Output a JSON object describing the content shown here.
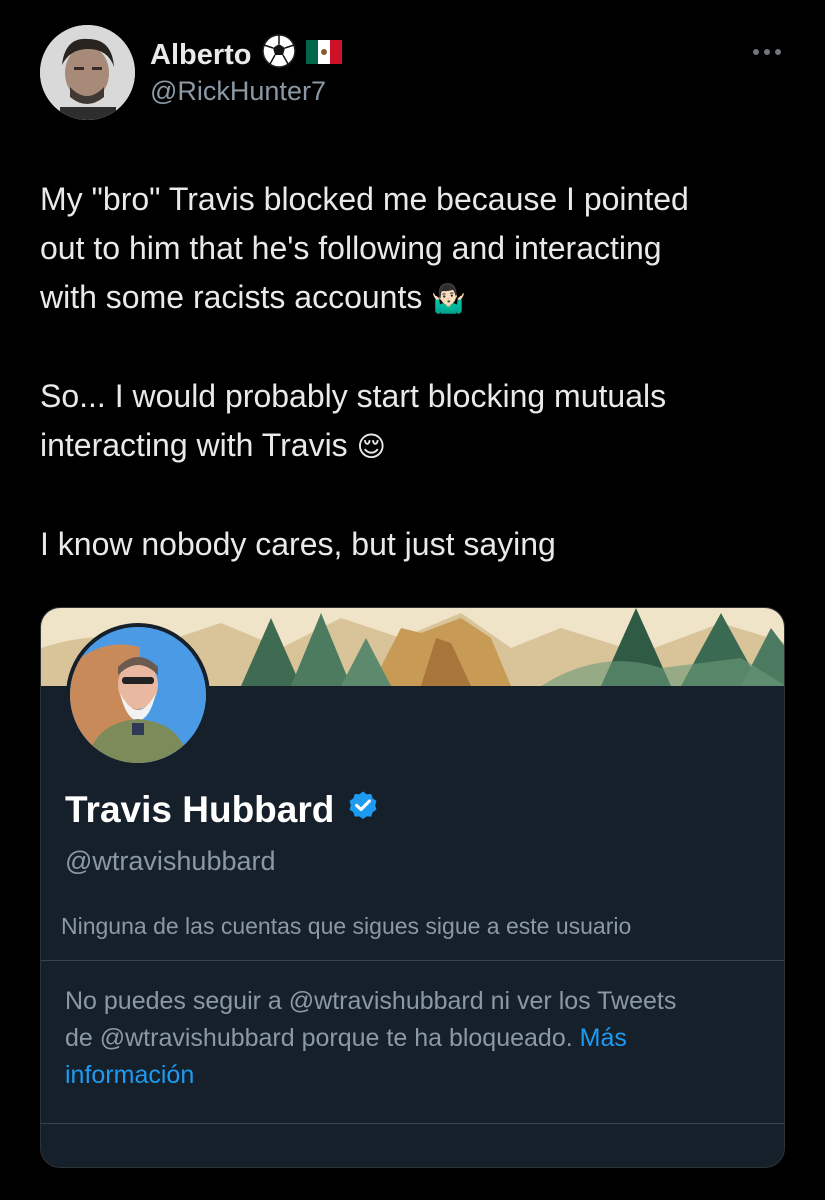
{
  "tweet": {
    "author": {
      "name": "Alberto",
      "handle": "@RickHunter7",
      "badges": [
        "soccer-ball-icon",
        "mexico-flag-icon"
      ]
    },
    "more_icon": "more-options-icon",
    "text_lines": [
      "My \"bro\" Travis blocked me because I pointed",
      "out to him that he's following and interacting",
      "with some racists accounts",
      "So... I would probably start blocking mutuals",
      "interacting with Travis",
      "I know nobody cares, but just saying"
    ],
    "emoji_shrug": "🤷🏻‍♂️",
    "emoji_relieved": "😌"
  },
  "profile_card": {
    "name": "Travis Hubbard",
    "verified_icon": "verified-badge-icon",
    "handle": "@wtravishubbard",
    "follow_note": "Ninguna de las cuentas que sigues sigue a este usuario",
    "blocked_text_1": "No puedes seguir a @wtravishubbard ni ver los Tweets",
    "blocked_text_2": "de @wtravishubbard porque te ha bloqueado.",
    "more_link_1": "Más",
    "more_link_2": "información"
  },
  "colors": {
    "background": "#000000",
    "card_background": "#15202b",
    "primary_text": "#e7e9ea",
    "secondary_text": "#8b98a5",
    "link": "#1d9bf0",
    "verified": "#1d9bf0"
  }
}
